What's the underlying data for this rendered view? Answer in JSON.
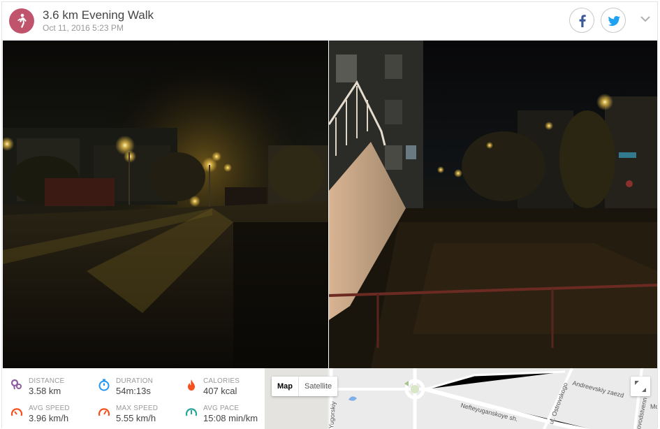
{
  "activity": {
    "icon": "walking-person-icon",
    "title": "3.6 km Evening Walk",
    "date": "Oct 11, 2016 5:23 PM"
  },
  "share": {
    "facebook_icon": "facebook-icon",
    "twitter_icon": "twitter-icon",
    "menu_icon": "chevron-down-icon"
  },
  "photos": [
    {
      "description_icon": "photo-night-street"
    },
    {
      "description_icon": "photo-night-building"
    }
  ],
  "stats": {
    "distance": {
      "label": "DISTANCE",
      "value": "3.58 km",
      "icon": "route-pins-icon"
    },
    "duration": {
      "label": "DURATION",
      "value": "54m:13s",
      "icon": "stopwatch-icon"
    },
    "calories": {
      "label": "CALORIES",
      "value": "407 kcal",
      "icon": "flame-icon"
    },
    "avg_speed": {
      "label": "AVG SPEED",
      "value": "3.96 km/h",
      "icon": "speedometer-icon"
    },
    "max_speed": {
      "label": "MAX SPEED",
      "value": "5.55 km/h",
      "icon": "speedometer-max-icon"
    },
    "avg_pace": {
      "label": "AVG PACE",
      "value": "15:08 min/km",
      "icon": "pace-gauge-icon"
    }
  },
  "map": {
    "type_options": [
      "Map",
      "Satellite"
    ],
    "selected_type": "Map",
    "labels": {
      "street1": "Nefteyuganskoye sh.",
      "street2": "Andreevskiy zaezd",
      "street3": "ul. Ostrovskogo",
      "street4": "Yugorskiy",
      "street5": "Mo",
      "street6": "ovodstvenn"
    }
  },
  "colors": {
    "accent": "#c0546c",
    "facebook": "#3b5998",
    "twitter": "#1da1f2",
    "stat_purple": "#8e5ea2",
    "stat_blue": "#2196f3",
    "stat_orange": "#f4511e",
    "stat_green": "#26a69a"
  }
}
